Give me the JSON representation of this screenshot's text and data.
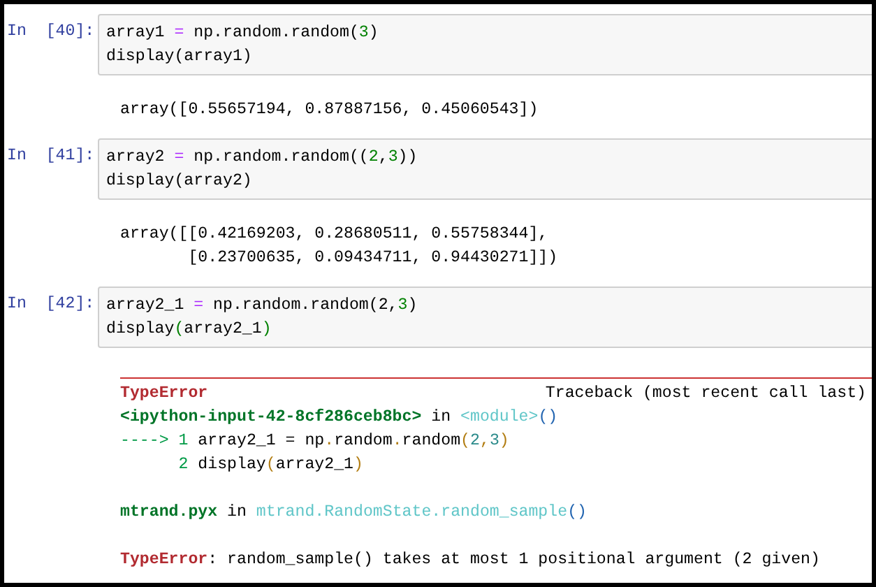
{
  "cells": [
    {
      "prompt": "In  [40]:",
      "code": [
        [
          {
            "t": "array1 ",
            "kind": "plain"
          },
          {
            "t": "=",
            "kind": "operator"
          },
          {
            "t": " np.random.random(",
            "kind": "plain"
          },
          {
            "t": "3",
            "kind": "literal"
          },
          {
            "t": ")",
            "kind": "plain"
          }
        ],
        [
          {
            "t": "display(array1)",
            "kind": "plain"
          }
        ]
      ],
      "output": {
        "kind": "text",
        "lines": [
          "array([0.55657194, 0.87887156, 0.45060543])"
        ]
      }
    },
    {
      "prompt": "In  [41]:",
      "code": [
        [
          {
            "t": "array2 ",
            "kind": "plain"
          },
          {
            "t": "=",
            "kind": "operator"
          },
          {
            "t": " np.random.random((",
            "kind": "plain"
          },
          {
            "t": "2",
            "kind": "literal"
          },
          {
            "t": ",",
            "kind": "plain"
          },
          {
            "t": "3",
            "kind": "literal"
          },
          {
            "t": "))",
            "kind": "plain"
          }
        ],
        [
          {
            "t": "display(array2)",
            "kind": "plain"
          }
        ]
      ],
      "output": {
        "kind": "text",
        "lines": [
          "array([[0.42169203, 0.28680511, 0.55758344],",
          "       [0.23700635, 0.09434711, 0.94430271]])"
        ]
      }
    },
    {
      "prompt": "In  [42]:",
      "code": [
        [
          {
            "t": "array2_1 ",
            "kind": "plain"
          },
          {
            "t": "=",
            "kind": "operator"
          },
          {
            "t": " np.random.random(2,",
            "kind": "plain"
          },
          {
            "t": "3",
            "kind": "literal"
          },
          {
            "t": ")",
            "kind": "plain"
          }
        ],
        [
          {
            "t": "display",
            "kind": "plain"
          },
          {
            "t": "(",
            "kind": "literal"
          },
          {
            "t": "array2_1",
            "kind": "plain"
          },
          {
            "t": ")",
            "kind": "literal"
          }
        ]
      ],
      "output": {
        "kind": "error",
        "ename": "TypeError",
        "traceback_label": "Traceback (most recent call last)",
        "blocks": [
          [
            [
              {
                "t": "<ipython-input-42-8cf286ceb8bc>",
                "kind": "file"
              },
              {
                "t": " in ",
                "kind": "plain"
              },
              {
                "t": "<module>",
                "kind": "link"
              },
              {
                "t": "()",
                "kind": "paren"
              }
            ],
            [
              {
                "t": "----> 1",
                "kind": "lineno"
              },
              {
                "t": " array2_1 = np",
                "kind": "plain"
              },
              {
                "t": ".",
                "kind": "punct"
              },
              {
                "t": "random",
                "kind": "plain"
              },
              {
                "t": ".",
                "kind": "punct"
              },
              {
                "t": "random",
                "kind": "plain"
              },
              {
                "t": "(",
                "kind": "punct"
              },
              {
                "t": "2",
                "kind": "number"
              },
              {
                "t": ",",
                "kind": "punct"
              },
              {
                "t": "3",
                "kind": "number"
              },
              {
                "t": ")",
                "kind": "punct"
              }
            ],
            [
              {
                "t": "      2",
                "kind": "lineno"
              },
              {
                "t": " display",
                "kind": "plain"
              },
              {
                "t": "(",
                "kind": "punct"
              },
              {
                "t": "array2_1",
                "kind": "plain"
              },
              {
                "t": ")",
                "kind": "punct"
              }
            ]
          ],
          [
            [
              {
                "t": "mtrand.pyx",
                "kind": "file"
              },
              {
                "t": " in ",
                "kind": "plain"
              },
              {
                "t": "mtrand.RandomState.random_sample",
                "kind": "link"
              },
              {
                "t": "()",
                "kind": "paren"
              }
            ]
          ],
          [
            [
              {
                "t": "TypeError",
                "kind": "ename"
              },
              {
                "t": ": random_sample() takes at most 1 positional argument (2 given)",
                "kind": "plain"
              }
            ]
          ]
        ]
      }
    }
  ]
}
